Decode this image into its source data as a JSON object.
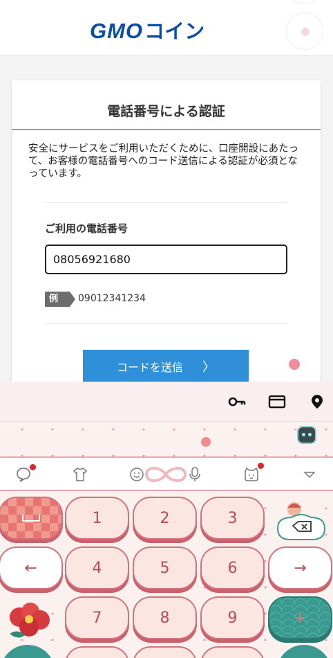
{
  "header": {
    "logo_text": "GMO",
    "logo_jp": "コイン",
    "logo_color": "#0a4ea8"
  },
  "card": {
    "title": "電話番号による認証",
    "description": "安全にサービスをご利用いただくために、口座開設にあたって、お客様の電話番号へのコード送信による認証が必須となっています。",
    "field_label": "ご利用の電話番号",
    "phone_value": "08056921680",
    "example_tag": "例",
    "example_number": "09012341234",
    "send_button": "コードを送信",
    "send_arrow": "〉",
    "accent_color": "#2f8fd8"
  },
  "keyboard": {
    "toolbar_icons": [
      "key-icon",
      "card-icon",
      "location-pin-icon"
    ],
    "emoji_row_icons": [
      "chat-bubble-icon",
      "shirt-icon",
      "smiley-icon",
      "infinity-icon",
      "microphone-icon",
      "cat-face-icon",
      "triangle-down-icon"
    ],
    "keys": {
      "k1": "1",
      "k2": "2",
      "k3": "3",
      "k4": "4",
      "k5": "5",
      "k6": "6",
      "k7": "7",
      "k8": "8",
      "k9": "9",
      "left": "←",
      "right": "→",
      "plus": "+"
    }
  }
}
